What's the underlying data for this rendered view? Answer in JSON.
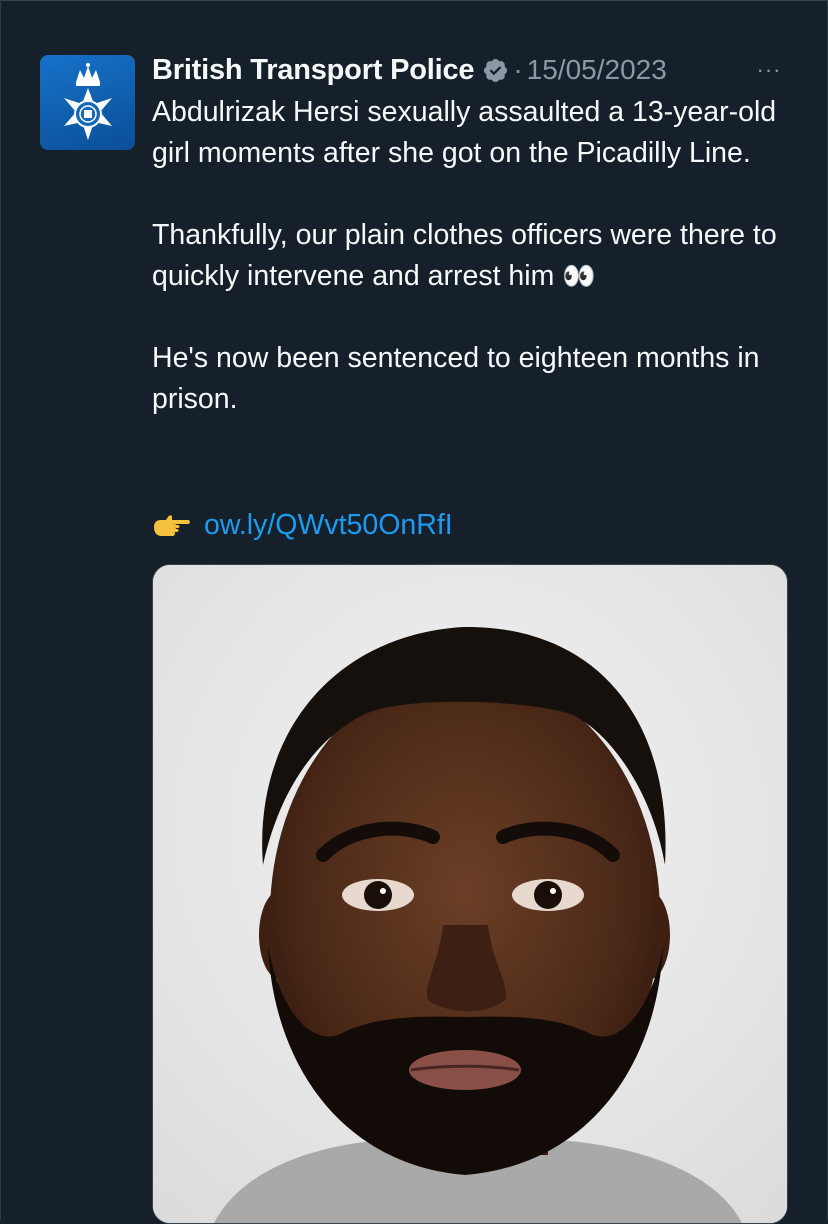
{
  "tweet": {
    "author": {
      "name": "British Transport Police",
      "avatar_icon": "police-crest-icon",
      "verified_icon": "verified-badge-icon",
      "verified_color": "#8b98a5"
    },
    "separator": "·",
    "date": "15/05/2023",
    "more_icon": "more-options-icon",
    "more_label": "···",
    "paragraphs": [
      "Abdulrizak Hersi sexually assaulted a 13-year-old girl moments after she got on the Picadilly Line.",
      "Thankfully, our plain clothes officers were there to quickly intervene and arrest him",
      "He's now been sentenced to eighteen months in prison."
    ],
    "eyes_emoji": "👀",
    "link": {
      "icon": "pointing-hand-icon",
      "text": "ow.ly/QWvt50OnRfI",
      "color": "#1d9bf0"
    },
    "media": {
      "type": "photo",
      "subject": "custody-photo"
    }
  },
  "theme": {
    "background": "#15202b",
    "text": "#f7f9f9",
    "muted": "#8b98a5",
    "accent": "#1d9bf0"
  }
}
